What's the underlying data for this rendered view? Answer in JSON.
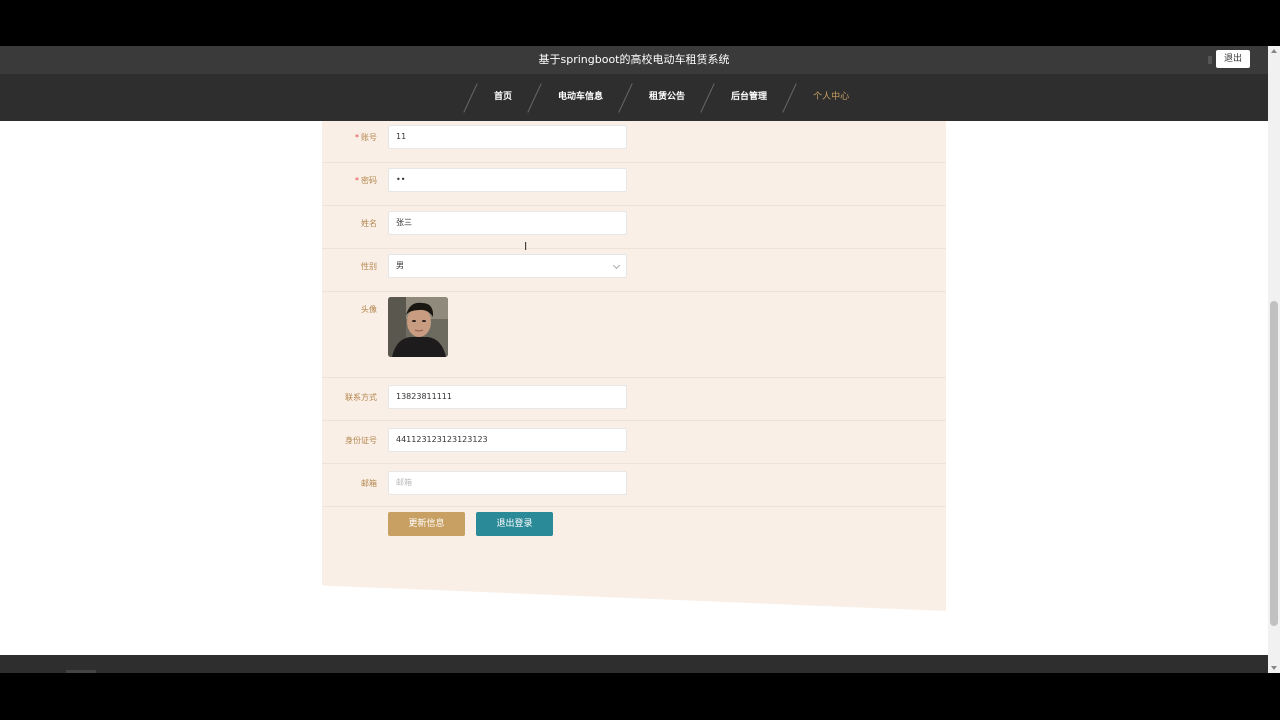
{
  "header": {
    "title": "基于springboot的高校电动车租赁系统",
    "logout_label": "退出"
  },
  "nav": {
    "items": [
      {
        "label": "首页"
      },
      {
        "label": "电动车信息"
      },
      {
        "label": "租赁公告"
      },
      {
        "label": "后台管理"
      },
      {
        "label": "个人中心"
      }
    ],
    "active": "个人中心"
  },
  "form": {
    "account": {
      "label": "账号",
      "required": "*",
      "value": "11"
    },
    "password": {
      "label": "密码",
      "required": "*",
      "value": "••"
    },
    "name": {
      "label": "姓名",
      "value": "张三"
    },
    "gender": {
      "label": "性别",
      "value": "男"
    },
    "avatar": {
      "label": "头像"
    },
    "phone": {
      "label": "联系方式",
      "value": "13823811111"
    },
    "id_card": {
      "label": "身份证号",
      "value": "441123123123123123"
    },
    "email": {
      "label": "邮箱",
      "value": "",
      "placeholder": "邮箱"
    }
  },
  "actions": {
    "update_label": "更新信息",
    "logout_label": "退出登录"
  },
  "colors": {
    "accent": "#c8a063",
    "teal": "#2b8a97",
    "panel_bg": "#faefe6",
    "nav_bg": "#2e2e2e"
  }
}
